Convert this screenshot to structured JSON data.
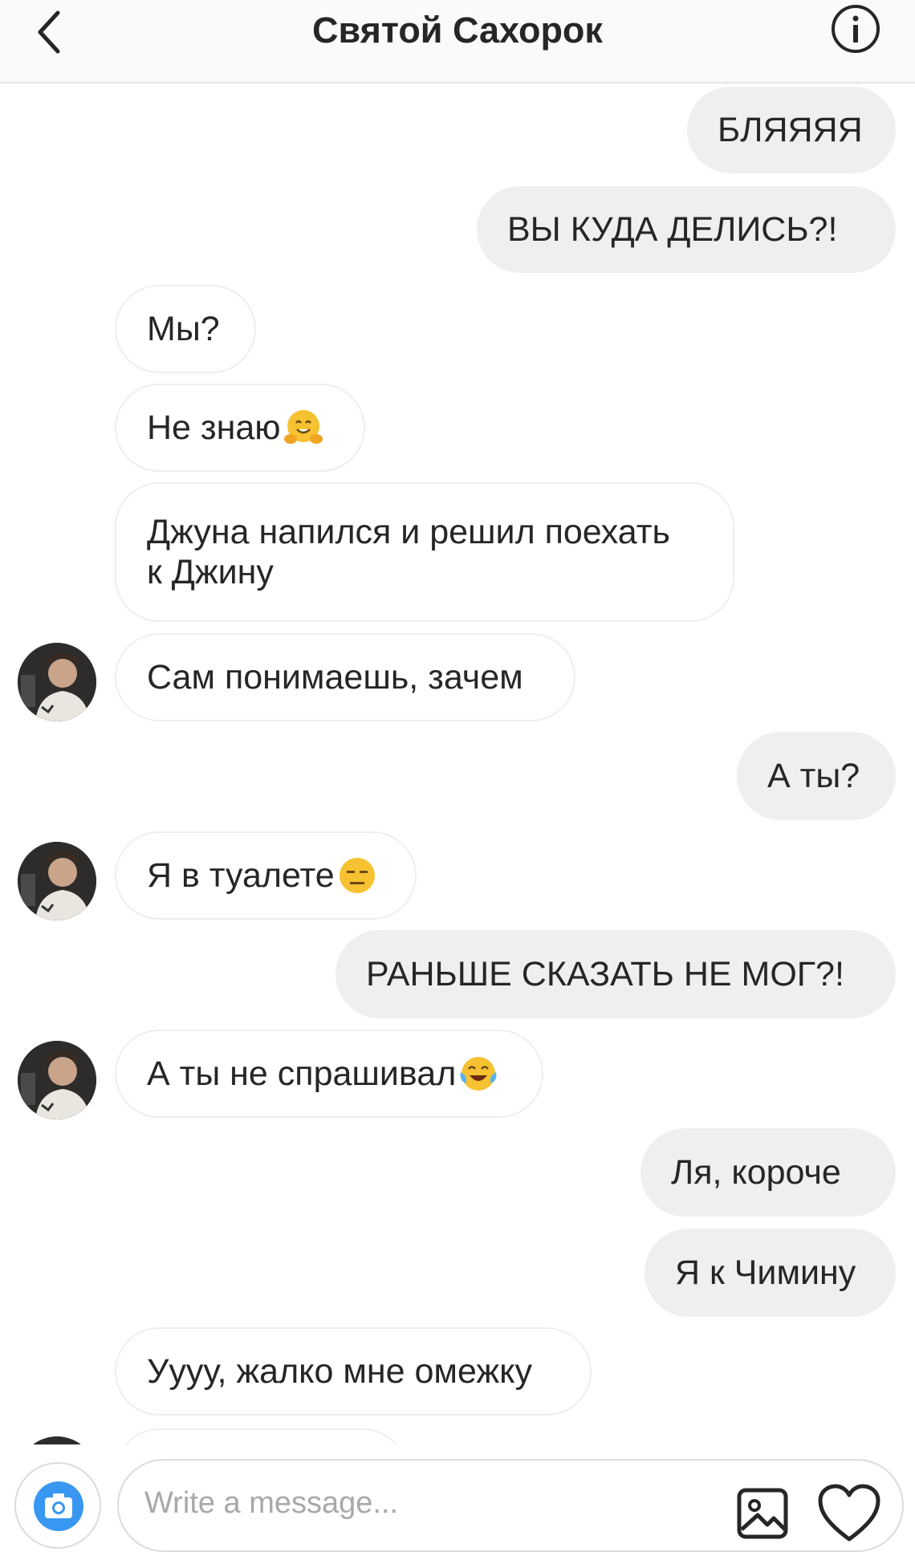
{
  "header": {
    "title": "Святой Сахорок",
    "back_icon": "chevron-left-icon",
    "info_icon": "info-icon"
  },
  "messages": [
    {
      "side": "out",
      "text": "БЛЯЯЯЯ"
    },
    {
      "side": "out",
      "text": "ВЫ КУДА ДЕЛИСЬ?!"
    },
    {
      "side": "in",
      "text": "Мы?"
    },
    {
      "side": "in",
      "text": "Не знаю",
      "emoji": "hugging-face-emoji"
    },
    {
      "side": "in",
      "text": "Джуна напился и решил поехать\nк Джину"
    },
    {
      "side": "in",
      "text": "Сам понимаешь, зачем",
      "avatar": true
    },
    {
      "side": "out",
      "text": "А ты?"
    },
    {
      "side": "in",
      "text": "Я в туалете",
      "emoji": "expressionless-face-emoji",
      "avatar": true
    },
    {
      "side": "out",
      "text": "РАНЬШЕ СКАЗАТЬ НЕ МОГ?!"
    },
    {
      "side": "in",
      "text": "А ты не спрашивал",
      "emoji": "tears-of-joy-emoji",
      "avatar": true
    },
    {
      "side": "out",
      "text": "Ля, короче"
    },
    {
      "side": "out",
      "text": "Я к Чимину"
    },
    {
      "side": "in",
      "text": "Уууу, жалко мне омежку"
    }
  ],
  "composer": {
    "placeholder": "Write a message...",
    "camera_icon": "camera-icon",
    "gallery_icon": "image-icon",
    "like_icon": "heart-icon",
    "camera_color": "#3897f0"
  }
}
